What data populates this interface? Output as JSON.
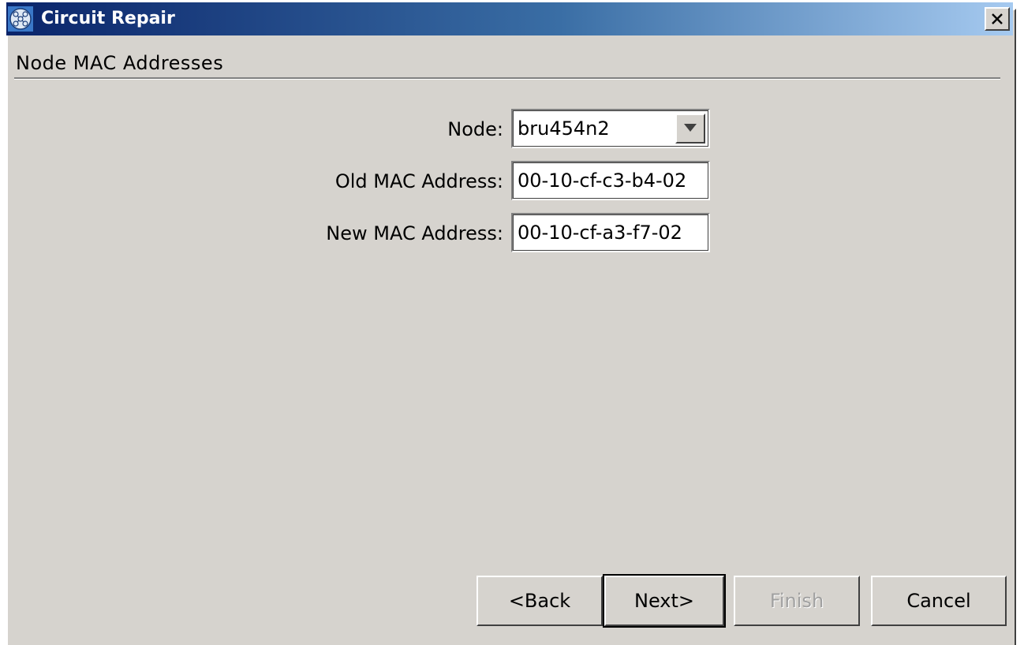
{
  "window": {
    "title": "Circuit Repair"
  },
  "section": {
    "title": "Node MAC Addresses"
  },
  "form": {
    "node_label": "Node:",
    "node_value": "bru454n2",
    "old_mac_label": "Old MAC Address:",
    "old_mac_value": "00-10-cf-c3-b4-02",
    "new_mac_label": "New MAC Address:",
    "new_mac_value": "00-10-cf-a3-f7-02"
  },
  "buttons": {
    "back": "<Back",
    "next": "Next>",
    "finish": "Finish",
    "cancel": "Cancel"
  },
  "icons": {
    "app": "network-globe-icon",
    "close": "close-icon",
    "dropdown": "chevron-down-icon"
  },
  "colors": {
    "titlebar_start": "#0a246a",
    "titlebar_end": "#a6caf0",
    "dialog_bg": "#d6d3ce"
  }
}
